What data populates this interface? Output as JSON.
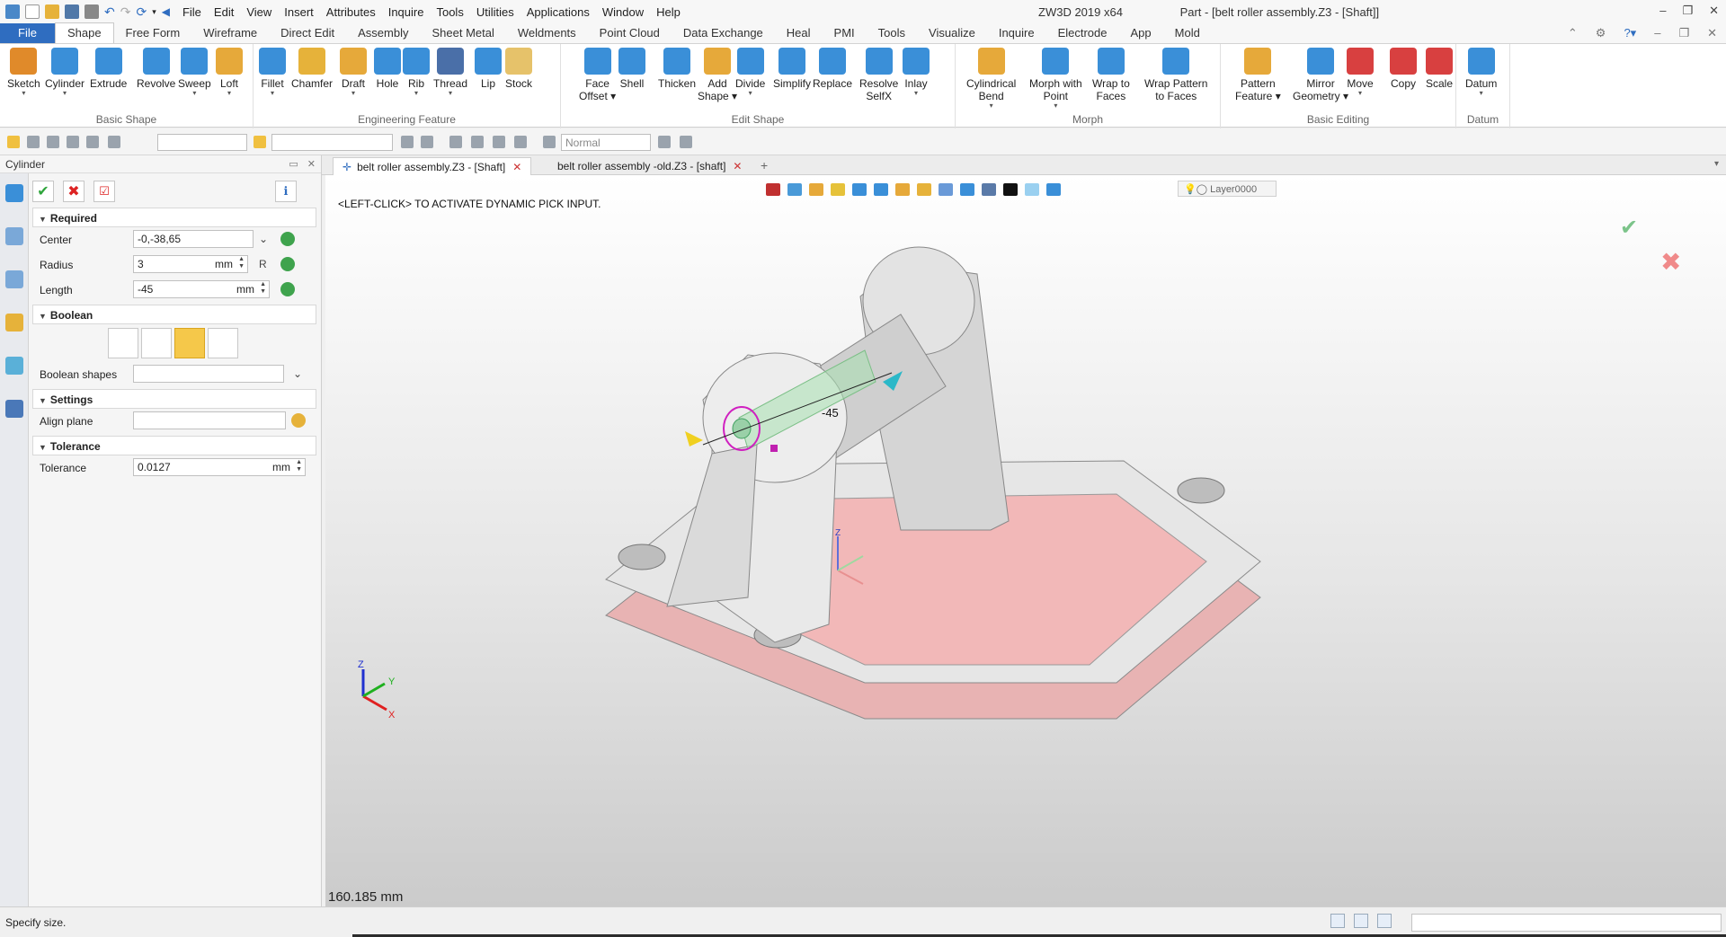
{
  "titlebar": {
    "menu": [
      "File",
      "Edit",
      "View",
      "Insert",
      "Attributes",
      "Inquire",
      "Tools",
      "Utilities",
      "Applications",
      "Window",
      "Help"
    ],
    "product": "ZW3D 2019  x64",
    "document": "Part - [belt roller assembly.Z3 - [Shaft]]"
  },
  "ribbon_tabs": [
    "File",
    "Shape",
    "Free Form",
    "Wireframe",
    "Direct Edit",
    "Assembly",
    "Sheet Metal",
    "Weldments",
    "Point Cloud",
    "Data Exchange",
    "Heal",
    "PMI",
    "Tools",
    "Visualize",
    "Inquire",
    "Electrode",
    "App",
    "Mold"
  ],
  "ribbon": {
    "groups": [
      {
        "label": "Basic Shape",
        "buttons": [
          {
            "line1": "Sketch",
            "line2": "",
            "dd": "true",
            "color": "#e08a2a"
          },
          {
            "line1": "Cylinder",
            "line2": "",
            "dd": "true",
            "color": "#3a8fd8"
          },
          {
            "line1": "Extrude",
            "line2": "",
            "dd": "",
            "color": "#3a8fd8"
          },
          {
            "line1": "Revolve",
            "line2": "",
            "dd": "",
            "color": "#3a8fd8"
          },
          {
            "line1": "Sweep",
            "line2": "",
            "dd": "true",
            "color": "#3a8fd8"
          },
          {
            "line1": "Loft",
            "line2": "",
            "dd": "true",
            "color": "#e6a93a"
          }
        ]
      },
      {
        "label": "Engineering Feature",
        "buttons": [
          {
            "line1": "Fillet",
            "line2": "",
            "dd": "true",
            "color": "#3a8fd8"
          },
          {
            "line1": "Chamfer",
            "line2": "",
            "dd": "",
            "color": "#e6b23a"
          },
          {
            "line1": "Draft",
            "line2": "",
            "dd": "true",
            "color": "#e6a93a"
          },
          {
            "line1": "Hole",
            "line2": "",
            "dd": "",
            "color": "#3a8fd8"
          },
          {
            "line1": "Rib",
            "line2": "",
            "dd": "true",
            "color": "#3a8fd8"
          },
          {
            "line1": "Thread",
            "line2": "",
            "dd": "true",
            "color": "#4a6fa8"
          },
          {
            "line1": "Lip",
            "line2": "",
            "dd": "",
            "color": "#3a8fd8"
          },
          {
            "line1": "Stock",
            "line2": "",
            "dd": "",
            "color": "#e6c26a"
          }
        ]
      },
      {
        "label": "Edit Shape",
        "buttons": [
          {
            "line1": "Face",
            "line2": "Offset ▾",
            "dd": "",
            "color": "#3a8fd8"
          },
          {
            "line1": "Shell",
            "line2": "",
            "dd": "",
            "color": "#3a8fd8"
          },
          {
            "line1": "Thicken",
            "line2": "",
            "dd": "",
            "color": "#3a8fd8"
          },
          {
            "line1": "Add",
            "line2": "Shape ▾",
            "dd": "",
            "color": "#e6a93a"
          },
          {
            "line1": "Divide",
            "line2": "",
            "dd": "true",
            "color": "#3a8fd8"
          },
          {
            "line1": "Simplify",
            "line2": "",
            "dd": "",
            "color": "#3a8fd8"
          },
          {
            "line1": "Replace",
            "line2": "",
            "dd": "",
            "color": "#3a8fd8"
          },
          {
            "line1": "Resolve",
            "line2": "SelfX",
            "dd": "",
            "color": "#3a8fd8"
          },
          {
            "line1": "Inlay",
            "line2": "",
            "dd": "true",
            "color": "#3a8fd8"
          }
        ]
      },
      {
        "label": "Morph",
        "buttons": [
          {
            "line1": "Cylindrical",
            "line2": "Bend",
            "dd": "true",
            "color": "#e6a93a"
          },
          {
            "line1": "Morph with",
            "line2": "Point",
            "dd": "true",
            "color": "#3a8fd8"
          },
          {
            "line1": "Wrap to",
            "line2": "Faces",
            "dd": "",
            "color": "#3a8fd8"
          },
          {
            "line1": "Wrap Pattern",
            "line2": "to Faces",
            "dd": "",
            "color": "#3a8fd8"
          }
        ]
      },
      {
        "label": "Basic Editing",
        "buttons": [
          {
            "line1": "Pattern",
            "line2": "Feature ▾",
            "dd": "",
            "color": "#e6a93a"
          },
          {
            "line1": "Mirror",
            "line2": "Geometry ▾",
            "dd": "",
            "color": "#3a8fd8"
          },
          {
            "line1": "Move",
            "line2": "",
            "dd": "true",
            "color": "#d84040"
          },
          {
            "line1": "Copy",
            "line2": "",
            "dd": "",
            "color": "#d84040"
          },
          {
            "line1": "Scale",
            "line2": "",
            "dd": "",
            "color": "#d84040"
          }
        ]
      },
      {
        "label": "Datum",
        "buttons": [
          {
            "line1": "Datum",
            "line2": "",
            "dd": "true",
            "color": "#3a8fd8"
          }
        ]
      }
    ]
  },
  "toolbar": {
    "combo_filter": "Normal"
  },
  "left_panel": {
    "title": "Cylinder",
    "sections": {
      "required": "Required",
      "boolean": "Boolean",
      "settings": "Settings",
      "tolerance": "Tolerance"
    },
    "fields": {
      "center_label": "Center",
      "center_value": "-0,-38,65",
      "radius_label": "Radius",
      "radius_value": "3",
      "radius_unit": "mm",
      "radius_extra": "R",
      "length_label": "Length",
      "length_value": "-45",
      "length_unit": "mm",
      "boolean_shapes_label": "Boolean shapes",
      "align_plane_label": "Align plane",
      "tolerance_label": "Tolerance",
      "tolerance_value": "0.0127",
      "tolerance_unit": "mm"
    }
  },
  "doc_tabs": [
    {
      "label": "belt roller assembly.Z3 - [Shaft]",
      "active": true
    },
    {
      "label": "belt roller assembly -old.Z3 - [shaft]",
      "active": false
    }
  ],
  "viewport": {
    "prompt": "<LEFT-CLICK> TO ACTIVATE DYNAMIC PICK INPUT.",
    "layer": "Layer0000",
    "dimension_label": "-45",
    "distance": "160.185 mm",
    "axis_labels": {
      "z": "Z",
      "y": "Y",
      "x": "X"
    }
  },
  "status": {
    "message": "Specify size."
  },
  "colors": {
    "accent": "#2f6dc0",
    "part_gray": "#d9d9d9",
    "base_pink": "#f0b4b4",
    "preview_green": "#a8e0b0",
    "ok_green": "#7cc48a",
    "cancel_red": "#f08a8a"
  }
}
